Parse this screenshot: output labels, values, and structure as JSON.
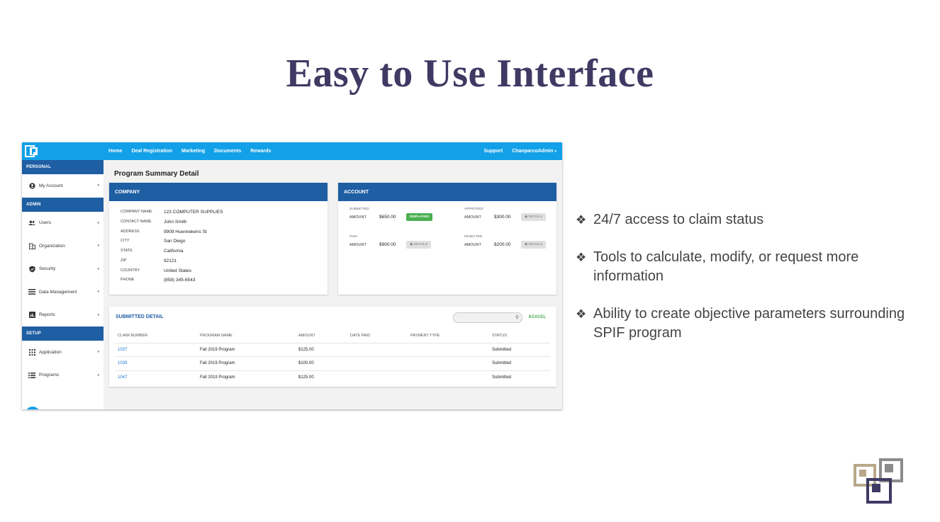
{
  "slide": {
    "title": "Easy to Use Interface"
  },
  "app": {
    "nav": [
      "Home",
      "Deal Registration",
      "Marketing",
      "Documents",
      "Rewards"
    ],
    "nav_right": {
      "support": "Support",
      "user": "ChanparcoAdmin",
      "user_caret": "▾"
    },
    "sidebar": {
      "sections": [
        {
          "header": "PERSONAL",
          "items": [
            {
              "label": "My Account",
              "icon": "account-circle-icon"
            }
          ]
        },
        {
          "header": "ADMIN",
          "items": [
            {
              "label": "Users",
              "icon": "users-icon"
            },
            {
              "label": "Organization",
              "icon": "building-icon"
            },
            {
              "label": "Security",
              "icon": "shield-icon"
            },
            {
              "label": "Data Management",
              "icon": "list-icon"
            },
            {
              "label": "Reports",
              "icon": "chart-icon"
            }
          ]
        },
        {
          "header": "SETUP",
          "items": [
            {
              "label": "Application",
              "icon": "grid-icon"
            },
            {
              "label": "Programs",
              "icon": "list-icon"
            }
          ]
        }
      ],
      "caret": "▾",
      "collapse": "‹"
    },
    "page_title": "Program Summary Detail",
    "company": {
      "header": "COMPANY",
      "fields": [
        {
          "k": "COMPANY NAME",
          "v": "123 COMPUTER SUPPLIES"
        },
        {
          "k": "CONTACT NAME",
          "v": "John Smith"
        },
        {
          "k": "ADDRESS",
          "v": "9909 Huennekens St"
        },
        {
          "k": "CITY",
          "v": "San Diego"
        },
        {
          "k": "STATE",
          "v": "California"
        },
        {
          "k": "ZIP",
          "v": "92121"
        },
        {
          "k": "COUNTRY",
          "v": "United States"
        },
        {
          "k": "PHONE",
          "v": "(858) 345-6543"
        }
      ]
    },
    "account": {
      "header": "ACCOUNT",
      "submitted": {
        "label": "SUBMITTED",
        "k": "AMOUNT",
        "v": "$650.00",
        "btn": "DISPLAYED"
      },
      "approved": {
        "label": "APPROVED",
        "k": "AMOUNT",
        "v": "$300.00",
        "btn": "DETAILS"
      },
      "paid": {
        "label": "PAID",
        "k": "AMOUNT",
        "v": "$900.00",
        "btn": "DETAILS"
      },
      "rejected": {
        "label": "REJECTED",
        "k": "AMOUNT",
        "v": "$200.00",
        "btn": "DETAILS"
      }
    },
    "submitted_detail": {
      "title": "SUBMITTED DETAIL",
      "excel": "EXCEL",
      "columns": [
        "CLAIM NUMBER",
        "PROGRAM NAME",
        "AMOUNT",
        "DATE PAID",
        "PAYMENT TYPE",
        "STATUS"
      ],
      "rows": [
        [
          "1037",
          "Fall 2019 Program",
          "$125.00",
          "",
          "",
          "Submitted"
        ],
        [
          "1039",
          "Fall 2019 Program",
          "$100.00",
          "",
          "",
          "Submitted"
        ],
        [
          "1047",
          "Fall 2019 Program",
          "$125.00",
          "",
          "",
          "Submitted"
        ]
      ]
    }
  },
  "bullets": [
    "24/7 access to claim status",
    "Tools to calculate, modify, or request more information",
    "Ability to create objective parameters surrounding SPIF program"
  ],
  "bullet_glyph": "❖",
  "colors": {
    "title": "#3e3a63",
    "topbar": "#12a0e8",
    "navy": "#1e5ea3",
    "green": "#4caf50"
  }
}
